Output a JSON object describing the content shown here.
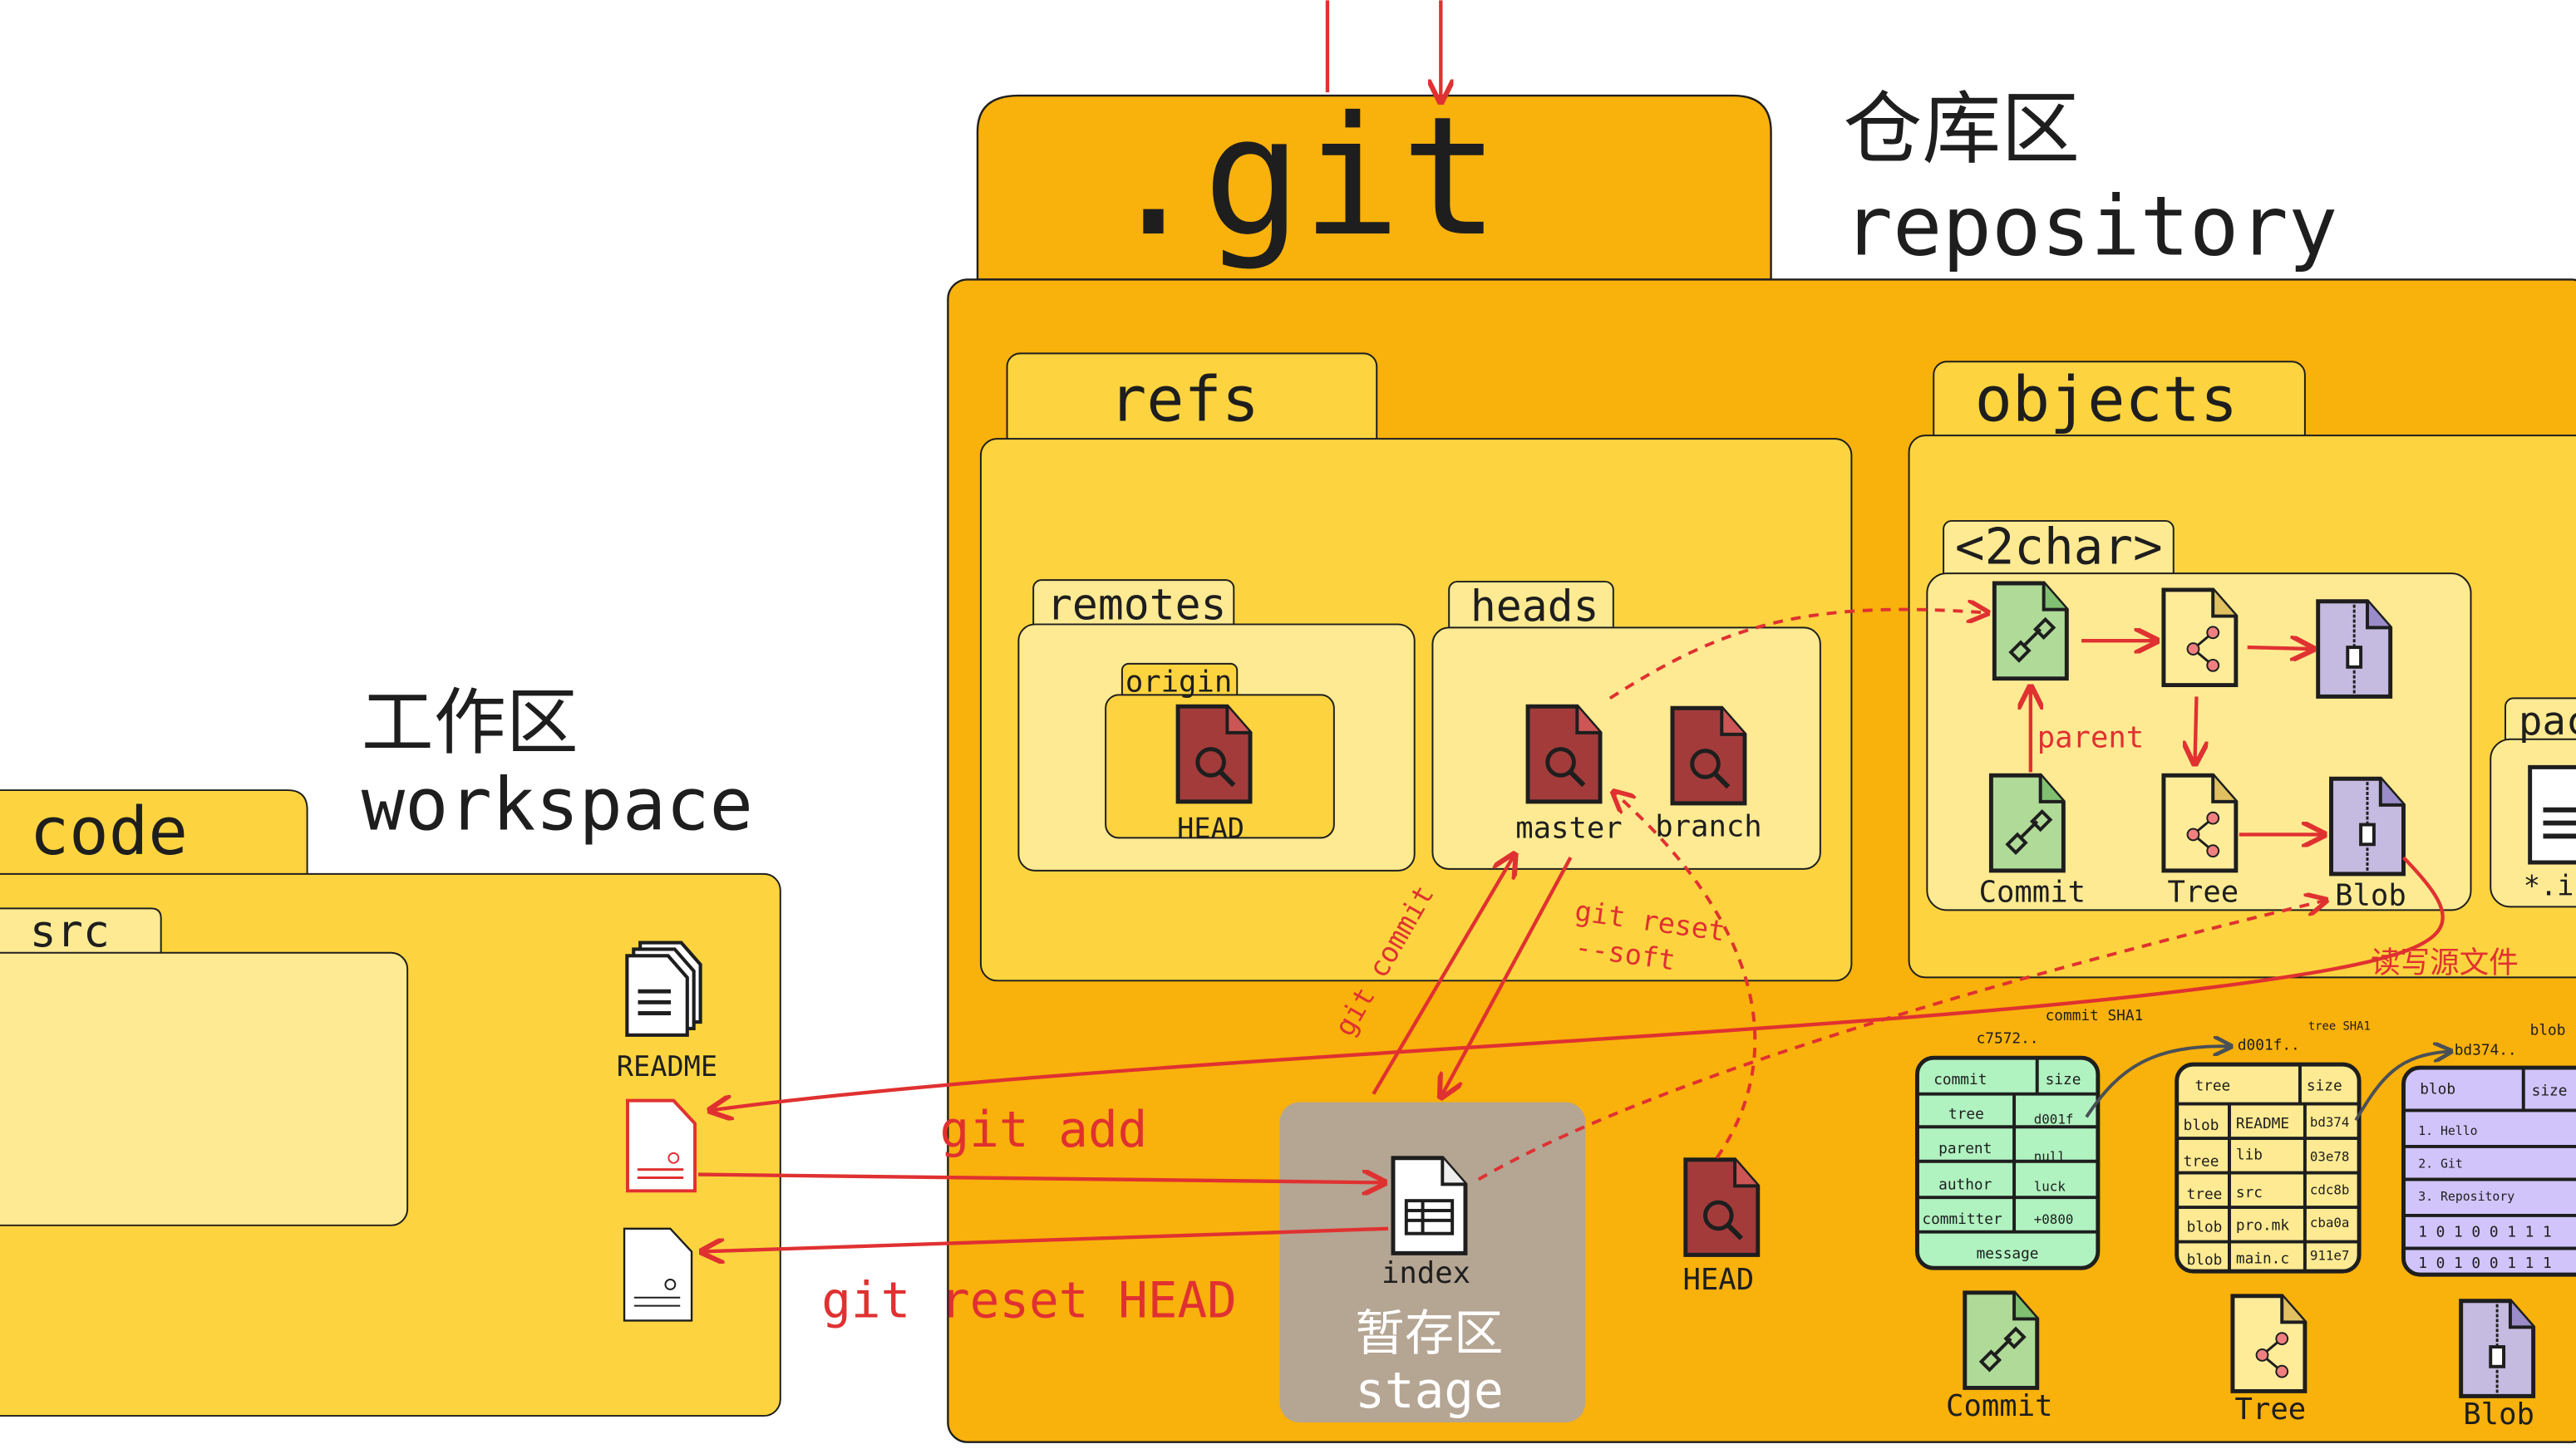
{
  "colors": {
    "git_folder": "#F9B10B",
    "panel": "#FDD43F",
    "inner_panel": "#FEEA92",
    "stage": "#B5A593",
    "arrow": "#E03131",
    "ref_icon": "#A33B3B",
    "commit": "#B0DA98",
    "tree": "#FFEC99",
    "blob": "#C5BAE0",
    "commit_table": "#B0F2C0",
    "blob_table": "#D0C4FA"
  },
  "repo": {
    "folder": ".git",
    "title_cn": "仓库区",
    "title_en": "repository"
  },
  "refs": {
    "label": "refs",
    "remotes": {
      "label": "remotes",
      "origin": {
        "label": "origin",
        "head": "HEAD"
      }
    },
    "heads": {
      "label": "heads",
      "master": "master",
      "branch": "branch"
    }
  },
  "objects": {
    "label": "objects",
    "twochar": {
      "label": "<2char>",
      "commit": "Commit",
      "tree": "Tree",
      "blob": "Blob",
      "parent": "parent"
    },
    "pack": {
      "label": "pac",
      "file": "*.i"
    },
    "rw_note": "读写源文件"
  },
  "workspace": {
    "title_cn": "工作区",
    "title_en": "workspace",
    "folder": "code",
    "subfolder": "src",
    "readme": "README"
  },
  "stage": {
    "file": "index",
    "title_cn": "暂存区",
    "title_en": "stage"
  },
  "head": "HEAD",
  "commands": {
    "add": "git add",
    "reset_head": "git reset HEAD",
    "commit": "git commit",
    "reset_soft_1": "git reset",
    "reset_soft_2": "--soft"
  },
  "commit_obj": {
    "sha_label": "commit SHA1",
    "sha": "c7572..",
    "header": [
      "commit",
      "size"
    ],
    "rows": [
      [
        "tree",
        "d001f"
      ],
      [
        "parent",
        "null"
      ],
      [
        "author",
        "luck"
      ],
      [
        "committer",
        "+0800"
      ]
    ],
    "footer": "message",
    "icon_label": "Commit"
  },
  "tree_obj": {
    "sha_label": "tree SHA1",
    "sha": "d001f..",
    "header": [
      "tree",
      "size"
    ],
    "rows": [
      [
        "blob",
        "README",
        "bd374"
      ],
      [
        "tree",
        "lib",
        "03e78"
      ],
      [
        "tree",
        "src",
        "cdc8b"
      ],
      [
        "blob",
        "pro.mk",
        "cba0a"
      ],
      [
        "blob",
        "main.c",
        "911e7"
      ]
    ],
    "icon_label": "Tree"
  },
  "blob_obj": {
    "sha_label": "blob",
    "sha": "bd374..",
    "header": [
      "blob",
      "size"
    ],
    "rows": [
      "1. Hello",
      "2. Git",
      "3. Repository",
      "1 0 1 0 0 1 1 1",
      "1 0 1 0 0 1 1 1"
    ],
    "icon_label": "Blob"
  }
}
